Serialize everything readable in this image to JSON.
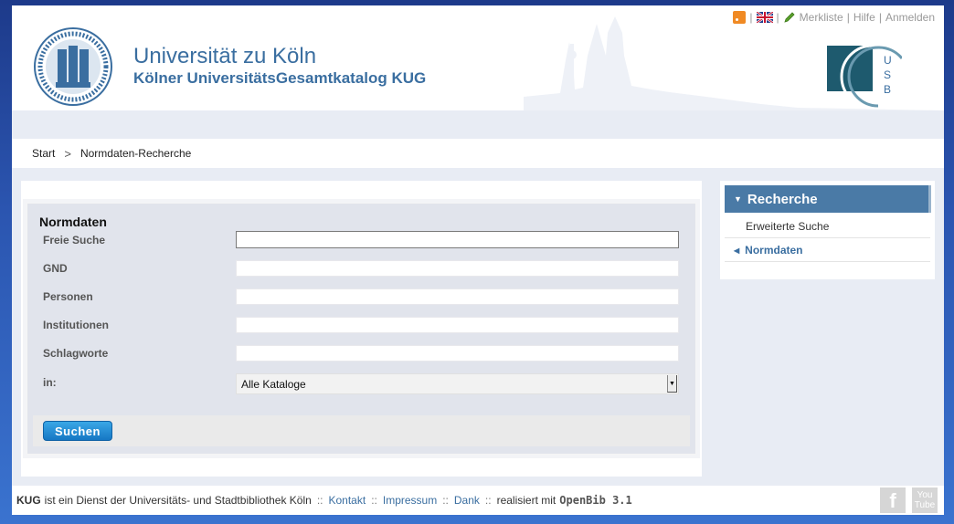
{
  "header": {
    "title": "Universität zu Köln",
    "subtitle": "Kölner UniversitätsGesamtkatalog KUG",
    "toplinks": {
      "rss_icon": "rss-icon",
      "lang_icon": "uk-flag-icon",
      "edit_icon": "pencil-icon",
      "merkliste": "Merkliste",
      "hilfe": "Hilfe",
      "anmelden": "Anmelden",
      "sep": "|"
    },
    "usb_letters": [
      "U",
      "S",
      "B"
    ]
  },
  "breadcrumb": {
    "start": "Start",
    "separator": ">",
    "current": "Normdaten-Recherche"
  },
  "form": {
    "title": "Normdaten",
    "fields": [
      {
        "label": "Freie Suche",
        "value": ""
      },
      {
        "label": "GND",
        "value": ""
      },
      {
        "label": "Personen",
        "value": ""
      },
      {
        "label": "Institutionen",
        "value": ""
      },
      {
        "label": "Schlagworte",
        "value": ""
      }
    ],
    "catalog_label": "in:",
    "catalog_selected": "Alle Kataloge",
    "submit": "Suchen"
  },
  "sidebar": {
    "heading": "Recherche",
    "items": [
      {
        "label": "Erweiterte Suche",
        "active": false
      },
      {
        "label": "Normdaten",
        "active": true
      }
    ]
  },
  "footer": {
    "brand": "KUG",
    "text": "ist ein Dienst der Universitäts- und Stadtbibliothek Köln",
    "sep": "::",
    "kontakt": "Kontakt",
    "impressum": "Impressum",
    "dank": "Dank",
    "powered": "realisiert mit",
    "engine": "OpenBib 3.1",
    "facebook": "f",
    "youtube_top": "You",
    "youtube_bottom": "Tube"
  },
  "colors": {
    "accent": "#3a6ea0",
    "sidebar_head": "#4a7aa6",
    "button": "#1677c4",
    "page_bg": "#e8ecf4"
  }
}
